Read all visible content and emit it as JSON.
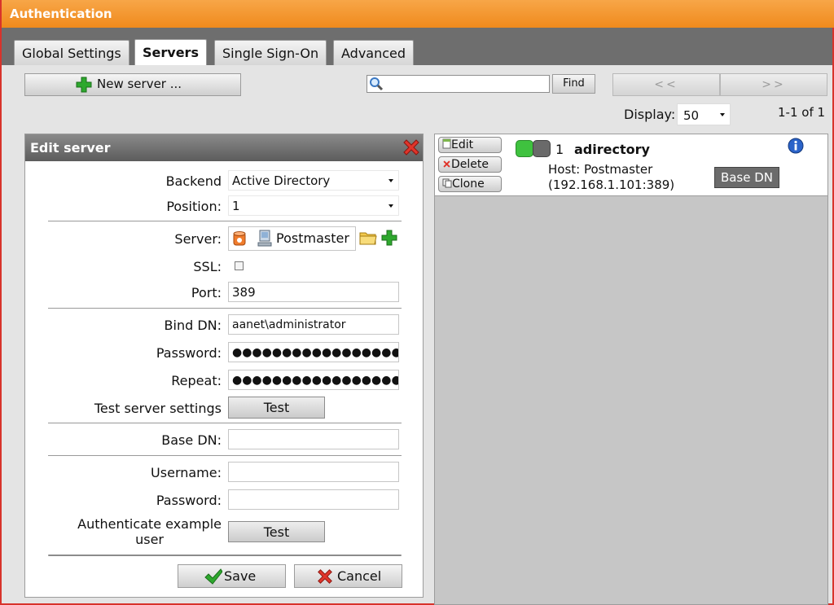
{
  "window": {
    "title": "Authentication"
  },
  "tabs": [
    {
      "label": "Global Settings",
      "active": false
    },
    {
      "label": "Servers",
      "active": true
    },
    {
      "label": "Single Sign-On",
      "active": false
    },
    {
      "label": "Advanced",
      "active": false
    }
  ],
  "toolbar": {
    "new_server_label": "New server ...",
    "search_value": "",
    "find_label": "Find",
    "prev_label": "<<",
    "next_label": ">>",
    "display_label": "Display:",
    "display_value": "50",
    "range_label": "1-1 of 1"
  },
  "edit_panel": {
    "title": "Edit server",
    "backend_label": "Backend",
    "backend_value": "Active Directory",
    "position_label": "Position:",
    "position_value": "1",
    "server_label": "Server:",
    "server_value": "Postmaster",
    "ssl_label": "SSL:",
    "ssl_checked": false,
    "port_label": "Port:",
    "port_value": "389",
    "bind_dn_label": "Bind DN:",
    "bind_dn_value": "aanet\\administrator",
    "password_label": "Password:",
    "password_value": "●●●●●●●●●●●●●●●●●●●",
    "repeat_label": "Repeat:",
    "repeat_value": "●●●●●●●●●●●●●●●●●●●",
    "test_settings_label": "Test server settings",
    "test_label": "Test",
    "base_dn_label": "Base DN:",
    "base_dn_value": "",
    "username_label": "Username:",
    "username_value": "",
    "example_password_label": "Password:",
    "example_password_value": "",
    "auth_example_label_1": "Authenticate example",
    "auth_example_label_2": "user",
    "auth_test_label": "Test",
    "save_label": "Save",
    "cancel_label": "Cancel"
  },
  "server_list": [
    {
      "edit_label": "Edit",
      "delete_label": "Delete",
      "clone_label": "Clone",
      "index": "1",
      "name": "adirectory",
      "host_line": "Host: Postmaster",
      "address_line": "(192.168.1.101:389)",
      "base_dn_button": "Base DN"
    }
  ],
  "colors": {
    "title_bar": "#f08a1c",
    "tab_strip": "#6e6e6e",
    "panel_header": "#6a6a6a",
    "close_red": "#e0352b",
    "plus_green": "#2ea82e"
  }
}
